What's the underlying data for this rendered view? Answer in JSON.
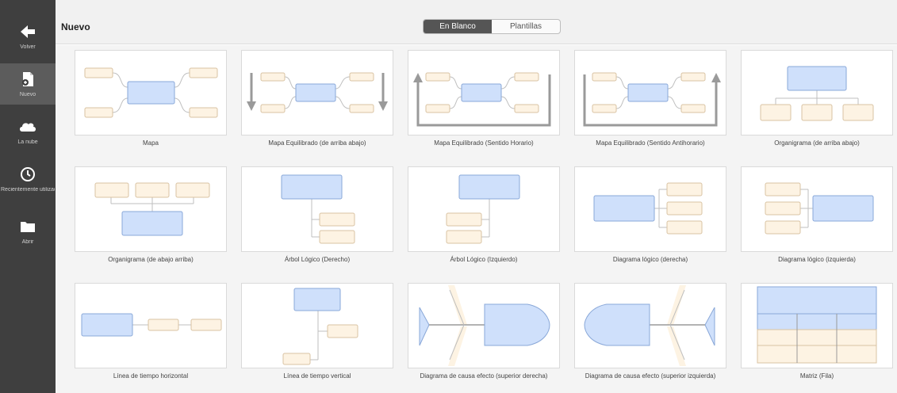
{
  "sidebar": {
    "items": [
      {
        "label": "Volver",
        "icon": "back-arrow-icon"
      },
      {
        "label": "Nuevo",
        "icon": "new-document-icon"
      },
      {
        "label": "La nube",
        "icon": "cloud-icon"
      },
      {
        "label": "Recientemente utilizado",
        "icon": "clock-icon"
      },
      {
        "label": "Abrir",
        "icon": "folder-icon"
      }
    ]
  },
  "header": {
    "title": "Nuevo",
    "tabs": [
      "En Blanco",
      "Plantillas"
    ],
    "active_tab": "En Blanco"
  },
  "templates": [
    {
      "label": "Mapa"
    },
    {
      "label": "Mapa Equilibrado (de arriba abajo)"
    },
    {
      "label": "Mapa Equilibrado (Sentido Horario)"
    },
    {
      "label": "Mapa Equilibrado (Sentido Antihorario)"
    },
    {
      "label": "Organigrama (de arriba abajo)"
    },
    {
      "label": "Organigrama (de abajo arriba)"
    },
    {
      "label": "Árbol Lógico (Derecho)"
    },
    {
      "label": "Árbol Lógico (Izquierdo)"
    },
    {
      "label": "Diagrama lógico (derecha)"
    },
    {
      "label": "Diagrama lógico (izquierda)"
    },
    {
      "label": "Línea de tiempo horizontal"
    },
    {
      "label": "Línea de tiempo vertical"
    },
    {
      "label": "Diagrama de causa efecto (superior derecha)"
    },
    {
      "label": "Diagrama de causa efecto (superior izquierda)"
    },
    {
      "label": "Matriz (Fila)"
    }
  ],
  "colors": {
    "sidebar_bg": "#3f3f3f",
    "main_topic": "#cfe0fb",
    "main_topic_border": "#8aa8d8",
    "sub_topic": "#fdf3e3",
    "sub_topic_border": "#d9c3a3"
  }
}
